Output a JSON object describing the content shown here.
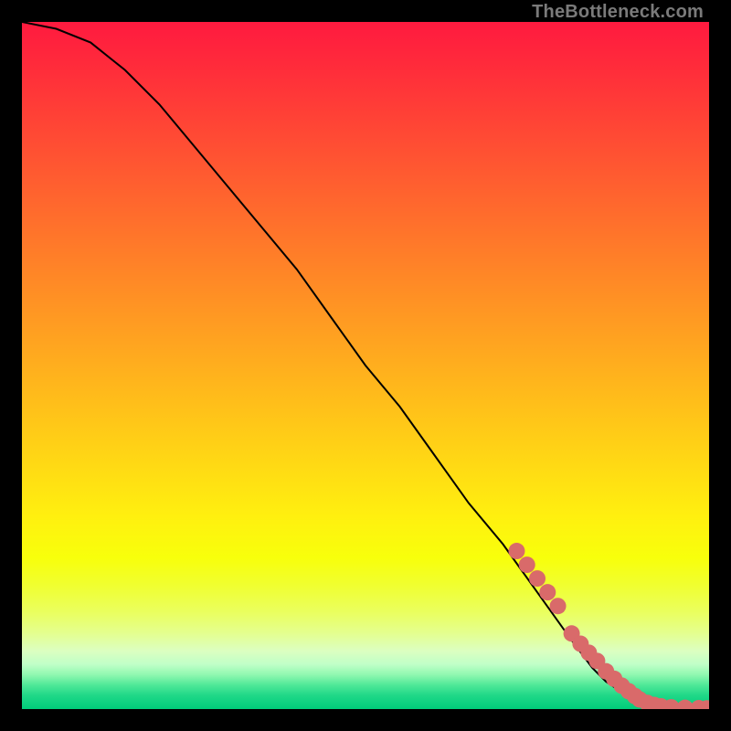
{
  "watermark": "TheBottleneck.com",
  "chart_data": {
    "type": "line",
    "title": "",
    "xlabel": "",
    "ylabel": "",
    "x_range": [
      0,
      100
    ],
    "y_range": [
      0,
      100
    ],
    "grid": false,
    "legend": false,
    "series": [
      {
        "name": "curve",
        "x": [
          0,
          5,
          10,
          15,
          20,
          25,
          30,
          35,
          40,
          45,
          50,
          55,
          60,
          65,
          70,
          75,
          80,
          83,
          85,
          88,
          90,
          92,
          94,
          96,
          98,
          100
        ],
        "y": [
          100,
          99,
          97,
          93,
          88,
          82,
          76,
          70,
          64,
          57,
          50,
          44,
          37,
          30,
          24,
          17,
          10,
          6,
          4,
          2,
          1,
          0.5,
          0.3,
          0.2,
          0.1,
          0.1
        ]
      }
    ],
    "markers": [
      {
        "name": "dots",
        "x": [
          72,
          73.5,
          75,
          76.5,
          78,
          80,
          81.3,
          82.5,
          83.7,
          85,
          86.2,
          87.3,
          88.3,
          89.2,
          89.9,
          91,
          92,
          93,
          94.5,
          96.5,
          98.5,
          99.7
        ],
        "y": [
          23,
          21,
          19,
          17,
          15,
          11,
          9.5,
          8.2,
          7,
          5.5,
          4.4,
          3.4,
          2.6,
          1.9,
          1.4,
          0.9,
          0.6,
          0.4,
          0.25,
          0.18,
          0.13,
          0.1
        ]
      }
    ],
    "gradient_rows": [
      {
        "y": 0.0,
        "c": "#ff1a3f"
      },
      {
        "y": 0.06,
        "c": "#ff2a3b"
      },
      {
        "y": 0.12,
        "c": "#ff3c37"
      },
      {
        "y": 0.18,
        "c": "#ff4e33"
      },
      {
        "y": 0.24,
        "c": "#ff602f"
      },
      {
        "y": 0.3,
        "c": "#ff722b"
      },
      {
        "y": 0.36,
        "c": "#ff8427"
      },
      {
        "y": 0.42,
        "c": "#ff9623"
      },
      {
        "y": 0.48,
        "c": "#ffa81f"
      },
      {
        "y": 0.54,
        "c": "#ffba1b"
      },
      {
        "y": 0.6,
        "c": "#ffcc17"
      },
      {
        "y": 0.66,
        "c": "#ffde13"
      },
      {
        "y": 0.72,
        "c": "#fff00f"
      },
      {
        "y": 0.78,
        "c": "#f8ff0b"
      },
      {
        "y": 0.82,
        "c": "#f0ff30"
      },
      {
        "y": 0.86,
        "c": "#eaff60"
      },
      {
        "y": 0.89,
        "c": "#e4ff90"
      },
      {
        "y": 0.915,
        "c": "#dcffc0"
      },
      {
        "y": 0.935,
        "c": "#c0ffc8"
      },
      {
        "y": 0.95,
        "c": "#90f8b0"
      },
      {
        "y": 0.965,
        "c": "#50e898"
      },
      {
        "y": 0.98,
        "c": "#20d888"
      },
      {
        "y": 1.0,
        "c": "#00cc7a"
      }
    ],
    "marker_color": "#d96a6a",
    "curve_color": "#000000"
  }
}
